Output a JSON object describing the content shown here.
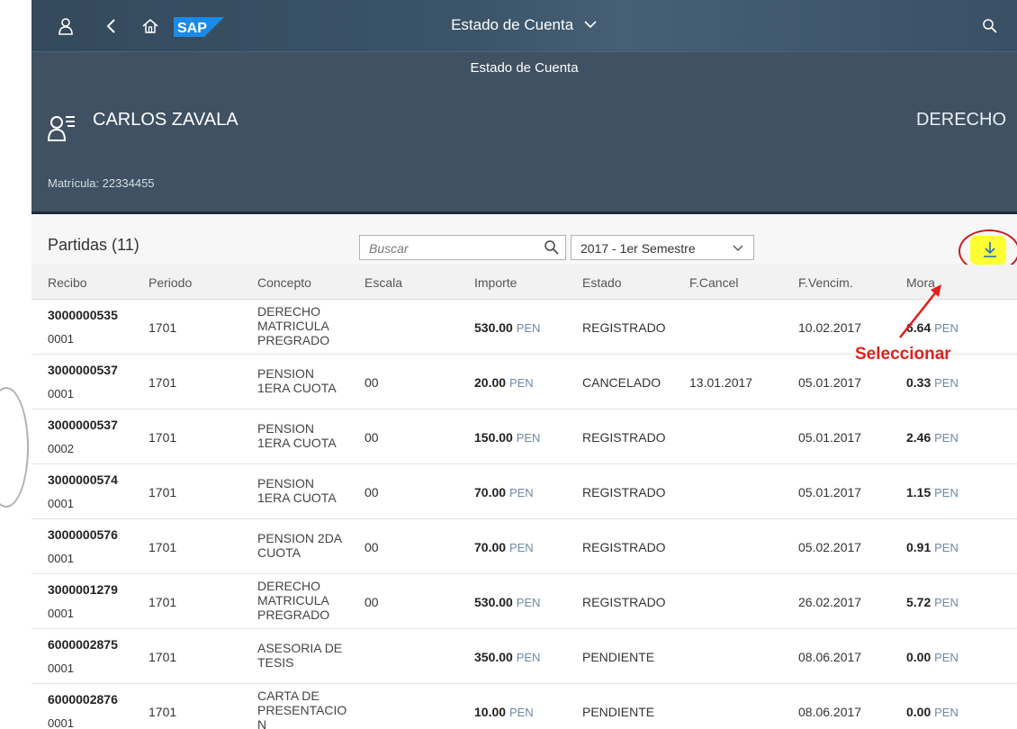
{
  "shell": {
    "title": "Estado de Cuenta",
    "logo_text": "SAP",
    "icons": [
      "user-icon",
      "back-icon",
      "home-icon",
      "search-icon"
    ]
  },
  "subbar": {
    "title": "Estado de Cuenta"
  },
  "header": {
    "name": "CARLOS ZAVALA",
    "right_text": "DERECHO",
    "matricula": "Matrícula: 22334455"
  },
  "toolbar": {
    "title": "Partidas (11)",
    "search_placeholder": "Buscar",
    "semester": "2017 - 1er Semestre"
  },
  "columns": [
    "Recibo",
    "Periodo",
    "Concepto",
    "Escala",
    "Importe",
    "Estado",
    "F.Cancel",
    "F.Vencim.",
    "Mora"
  ],
  "rows": [
    {
      "recibo": "3000000535",
      "pos": "0001",
      "periodo": "1701",
      "concepto": "DERECHO MATRICULA PREGRADO",
      "escala": "",
      "importe": "530.00",
      "estado": "REGISTRADO",
      "fcancel": "",
      "fvencim": "10.02.2017",
      "mora": "6.64"
    },
    {
      "recibo": "3000000537",
      "pos": "0001",
      "periodo": "1701",
      "concepto": "PENSION 1ERA CUOTA",
      "escala": "00",
      "importe": "20.00",
      "estado": "CANCELADO",
      "fcancel": "13.01.2017",
      "fvencim": "05.01.2017",
      "mora": "0.33"
    },
    {
      "recibo": "3000000537",
      "pos": "0002",
      "periodo": "1701",
      "concepto": "PENSION 1ERA CUOTA",
      "escala": "00",
      "importe": "150.00",
      "estado": "REGISTRADO",
      "fcancel": "",
      "fvencim": "05.01.2017",
      "mora": "2.46"
    },
    {
      "recibo": "3000000574",
      "pos": "0001",
      "periodo": "1701",
      "concepto": "PENSION 1ERA CUOTA",
      "escala": "00",
      "importe": "70.00",
      "estado": "REGISTRADO",
      "fcancel": "",
      "fvencim": "05.01.2017",
      "mora": "1.15"
    },
    {
      "recibo": "3000000576",
      "pos": "0001",
      "periodo": "1701",
      "concepto": "PENSION 2DA CUOTA",
      "escala": "00",
      "importe": "70.00",
      "estado": "REGISTRADO",
      "fcancel": "",
      "fvencim": "05.02.2017",
      "mora": "0.91"
    },
    {
      "recibo": "3000001279",
      "pos": "0001",
      "periodo": "1701",
      "concepto": "DERECHO MATRICULA PREGRADO",
      "escala": "00",
      "importe": "530.00",
      "estado": "REGISTRADO",
      "fcancel": "",
      "fvencim": "26.02.2017",
      "mora": "5.72"
    },
    {
      "recibo": "6000002875",
      "pos": "0001",
      "periodo": "1701",
      "concepto": "ASESORIA DE TESIS",
      "escala": "",
      "importe": "350.00",
      "estado": "PENDIENTE",
      "fcancel": "",
      "fvencim": "08.06.2017",
      "mora": "0.00"
    },
    {
      "recibo": "6000002876",
      "pos": "0001",
      "periodo": "1701",
      "concepto": "CARTA DE PRESENTACIO N",
      "escala": "",
      "importe": "10.00",
      "estado": "PENDIENTE",
      "fcancel": "",
      "fvencim": "08.06.2017",
      "mora": "0.00"
    }
  ],
  "currency": "PEN",
  "annotation": {
    "text": "Seleccionar",
    "color": "#e0201c"
  },
  "colors": {
    "shell": "#34495c",
    "header": "#3f5162",
    "highlight": "#ffff33",
    "currency": "#6d8aa6"
  }
}
